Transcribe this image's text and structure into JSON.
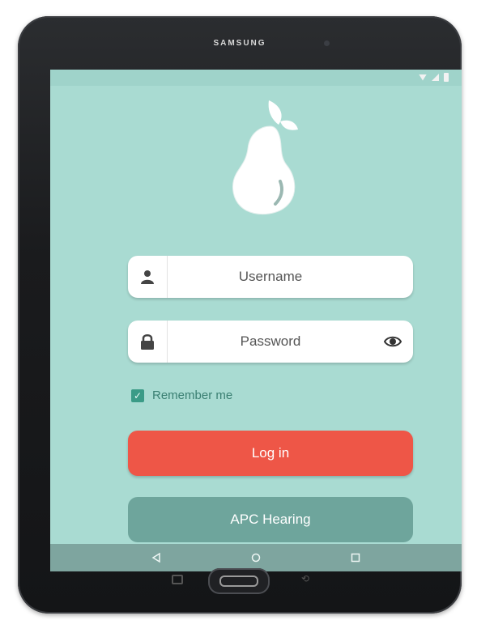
{
  "device": {
    "brand": "SAMSUNG"
  },
  "status_bar": {
    "time": ""
  },
  "login": {
    "username_placeholder": "Username",
    "password_placeholder": "Password",
    "remember_label": "Remember me",
    "remember_checked": true,
    "login_button": "Log in",
    "apc_button": "APC Hearing"
  },
  "colors": {
    "screen_bg": "#a9dbd2",
    "login_button": "#ee5647",
    "secondary_button": "#6ea59c",
    "checkbox": "#3b9b87",
    "nav_bar": "#7ea59f"
  },
  "icons": {
    "logo": "pear-logo",
    "username": "user-icon",
    "password": "lock-icon",
    "show_password": "eye-icon",
    "nav": [
      "back-icon",
      "home-icon",
      "recents-icon"
    ]
  }
}
